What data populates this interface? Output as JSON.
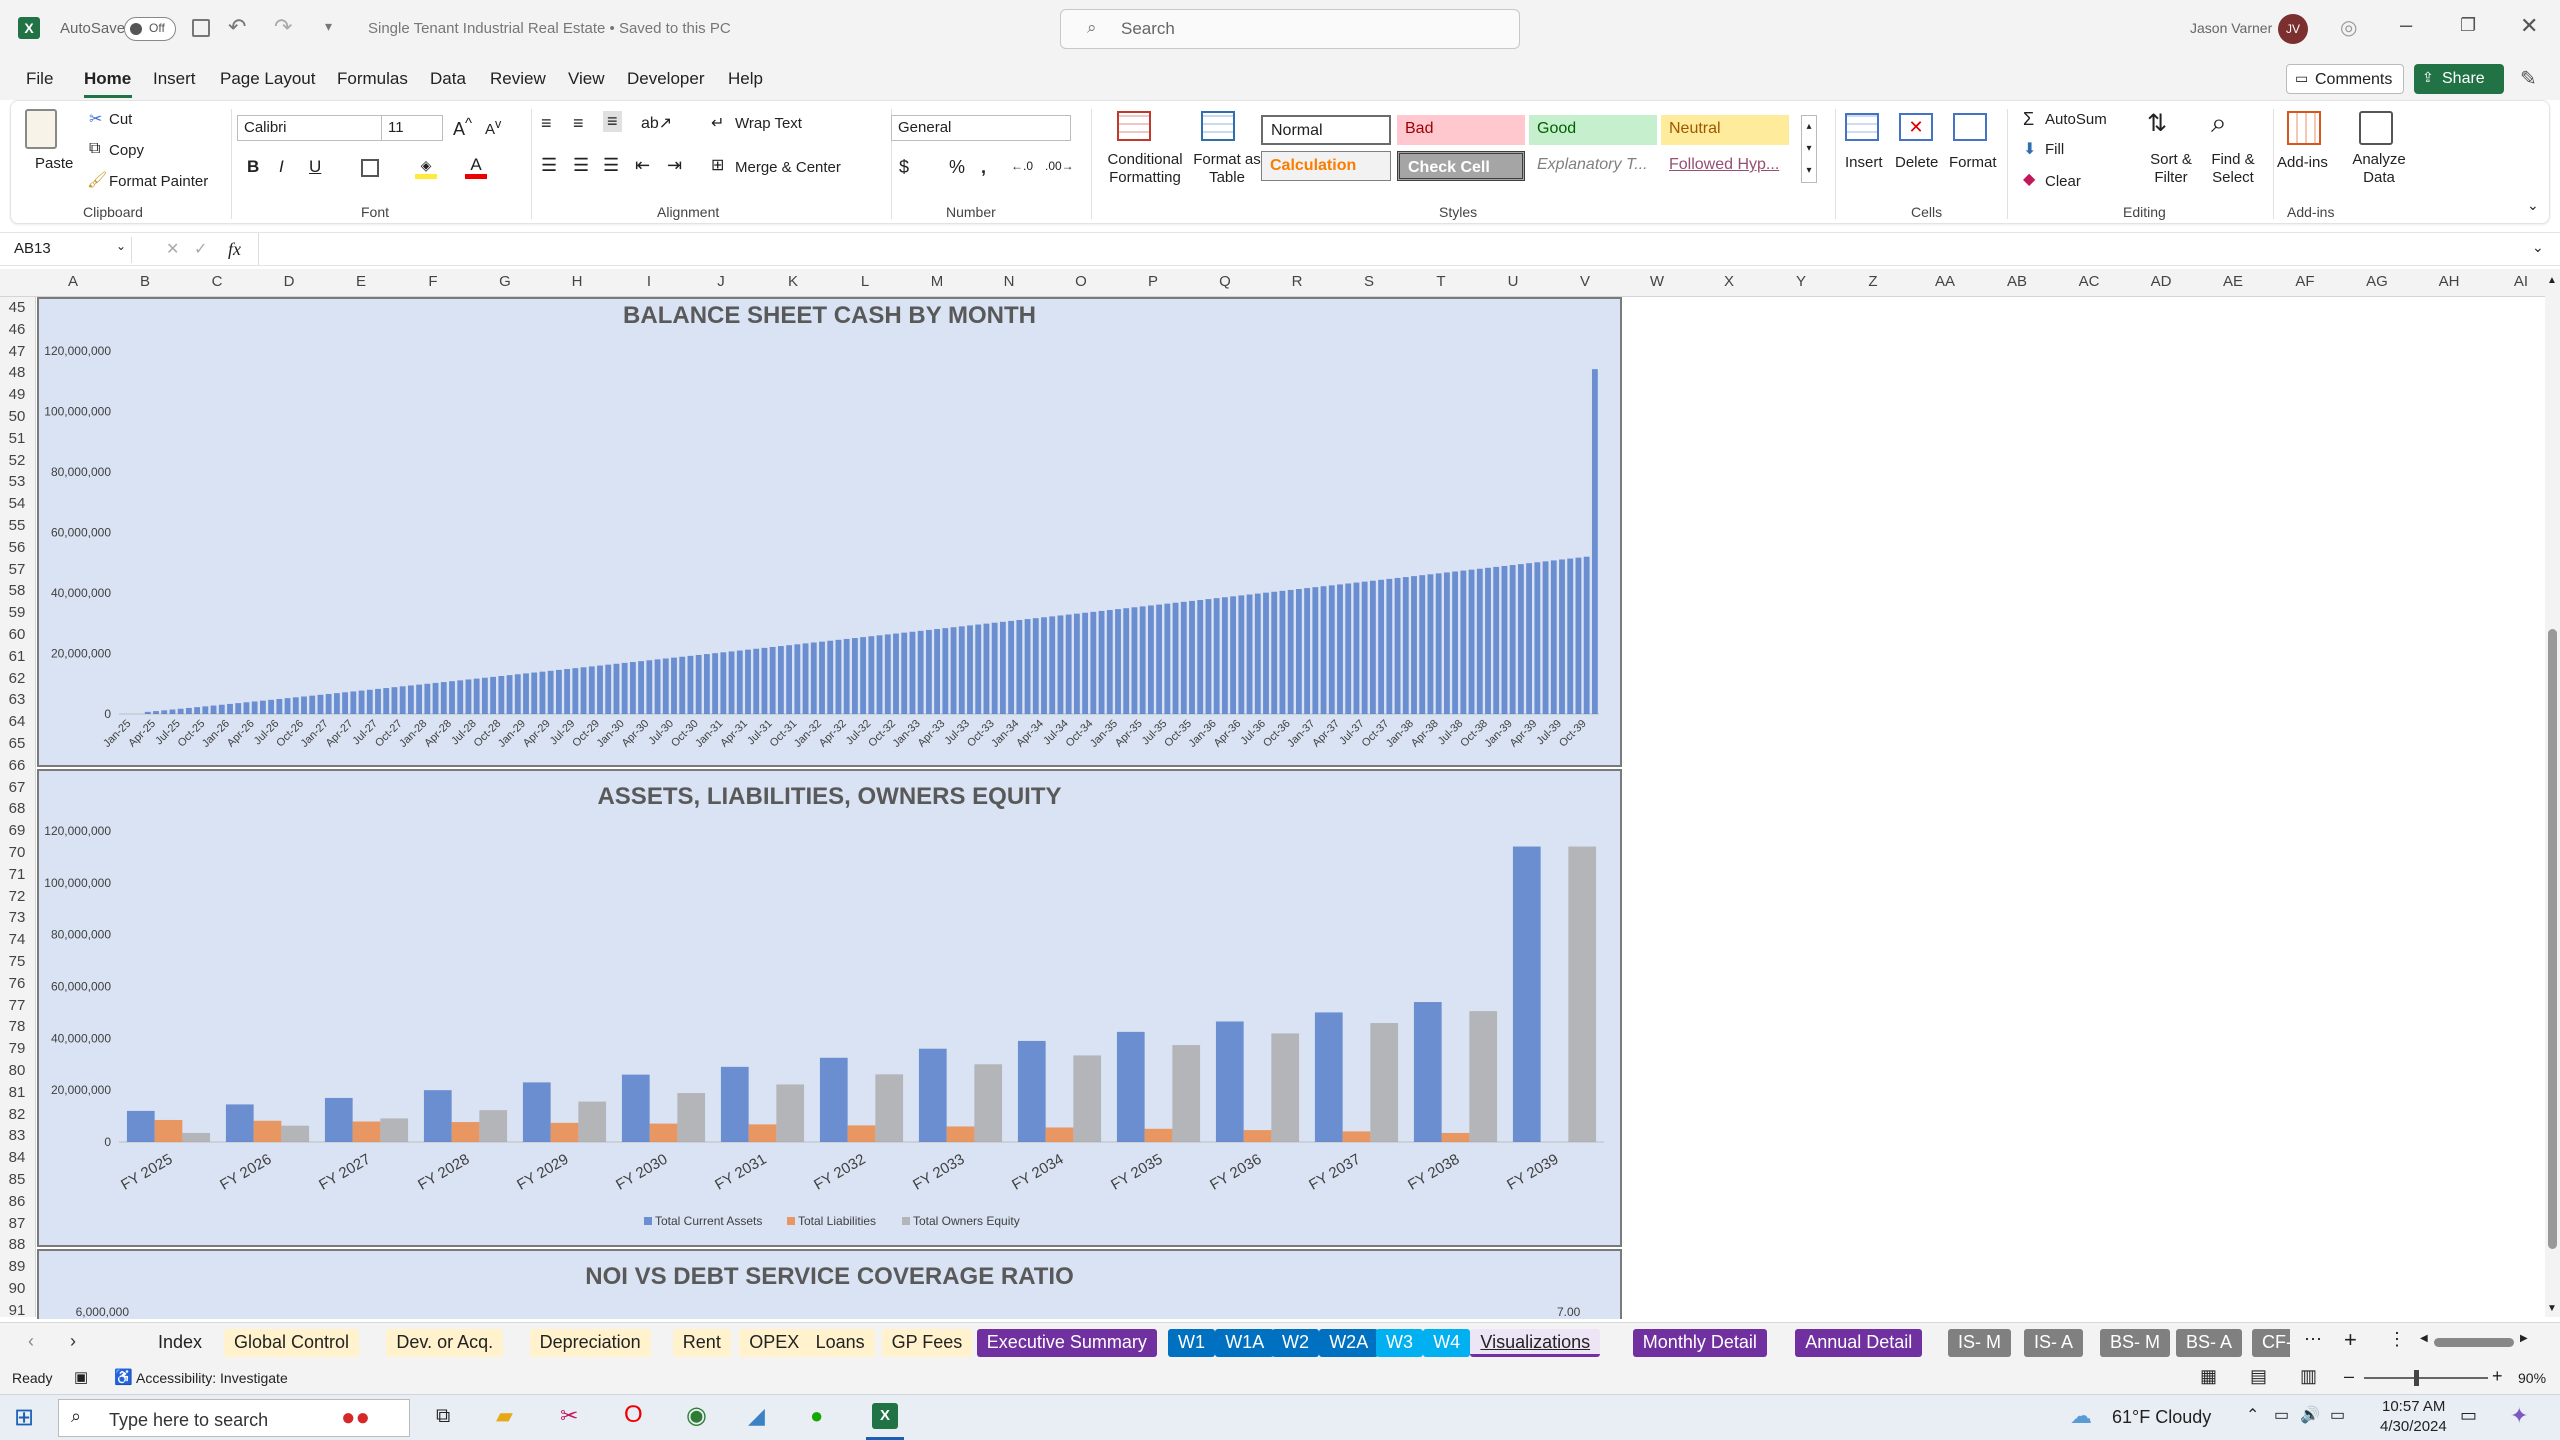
{
  "app": {
    "autosave_label": "AutoSave",
    "autosave_state": "Off",
    "doc_title": "Single Tenant Industrial Real Estate • Saved to this PC",
    "search_placeholder": "Search",
    "user_name": "Jason Varner",
    "user_initials": "JV",
    "excel_color": "#217346"
  },
  "menu": {
    "items": [
      "File",
      "Home",
      "Insert",
      "Page Layout",
      "Formulas",
      "Data",
      "Review",
      "View",
      "Developer",
      "Help"
    ],
    "active": "Home",
    "comments_label": "Comments",
    "share_label": "Share"
  },
  "ribbon": {
    "clipboard": {
      "paste": "Paste",
      "cut": "Cut",
      "copy": "Copy",
      "format_painter": "Format Painter",
      "group": "Clipboard"
    },
    "font": {
      "name": "Calibri",
      "size": "11",
      "group": "Font",
      "bold": "B",
      "italic": "I",
      "underline": "U"
    },
    "alignment": {
      "wrap": "Wrap Text",
      "merge": "Merge & Center",
      "group": "Alignment"
    },
    "number": {
      "format": "General",
      "group": "Number"
    },
    "styles": {
      "conditional": "Conditional Formatting",
      "format_table": "Format as Table",
      "cells": [
        "Normal",
        "Bad",
        "Good",
        "Neutral",
        "Calculation",
        "Check Cell",
        "Explanatory T...",
        "Followed Hyp..."
      ],
      "group": "Styles"
    },
    "cells": {
      "insert": "Insert",
      "delete": "Delete",
      "format": "Format",
      "group": "Cells"
    },
    "editing": {
      "autosum": "AutoSum",
      "fill": "Fill",
      "clear": "Clear",
      "sort": "Sort & Filter",
      "find": "Find & Select",
      "group": "Editing"
    },
    "addins": {
      "addins": "Add-ins",
      "analyze": "Analyze Data",
      "group": "Add-ins"
    }
  },
  "formula_bar": {
    "name_box": "AB13",
    "fx": "fx",
    "value": ""
  },
  "columns": [
    "A",
    "B",
    "C",
    "D",
    "E",
    "F",
    "G",
    "H",
    "I",
    "J",
    "K",
    "L",
    "M",
    "N",
    "O",
    "P",
    "Q",
    "R",
    "S",
    "T",
    "U",
    "V",
    "W",
    "X",
    "Y",
    "Z",
    "AA",
    "AB",
    "AC",
    "AD",
    "AE",
    "AF",
    "AG",
    "AH",
    "AI"
  ],
  "rows": [
    "45",
    "46",
    "47",
    "48",
    "49",
    "50",
    "51",
    "52",
    "53",
    "54",
    "55",
    "56",
    "57",
    "58",
    "59",
    "60",
    "61",
    "62",
    "63",
    "64",
    "65",
    "66",
    "67",
    "68",
    "69",
    "70",
    "71",
    "72",
    "73",
    "74",
    "75",
    "76",
    "77",
    "78",
    "79",
    "80",
    "81",
    "82",
    "83",
    "84",
    "85",
    "86",
    "87",
    "88",
    "89",
    "90",
    "91"
  ],
  "chart_data": [
    {
      "type": "bar",
      "title": "BALANCE SHEET CASH BY MONTH",
      "ylim": [
        0,
        120000000
      ],
      "yticks": [
        "0",
        "20,000,000",
        "40,000,000",
        "60,000,000",
        "80,000,000",
        "100,000,000",
        "120,000,000"
      ],
      "xlabels": [
        "Jan-25",
        "Apr-25",
        "Jul-25",
        "Oct-25",
        "Jan-26",
        "Apr-26",
        "Jul-26",
        "Oct-26",
        "Jan-27",
        "Apr-27",
        "Jul-27",
        "Oct-27",
        "Jan-28",
        "Apr-28",
        "Jul-28",
        "Oct-28",
        "Jan-29",
        "Apr-29",
        "Jul-29",
        "Oct-29",
        "Jan-30",
        "Apr-30",
        "Jul-30",
        "Oct-30",
        "Jan-31",
        "Apr-31",
        "Jul-31",
        "Oct-31",
        "Jan-32",
        "Apr-32",
        "Jul-32",
        "Oct-32",
        "Jan-33",
        "Apr-33",
        "Jul-33",
        "Oct-33",
        "Jan-34",
        "Apr-34",
        "Jul-34",
        "Oct-34",
        "Jan-35",
        "Apr-35",
        "Jul-35",
        "Oct-35",
        "Jan-36",
        "Apr-36",
        "Jul-36",
        "Oct-36",
        "Jan-37",
        "Apr-37",
        "Jul-37",
        "Oct-37",
        "Jan-38",
        "Apr-38",
        "Jul-38",
        "Oct-38",
        "Jan-39",
        "Apr-39",
        "Jul-39",
        "Oct-39"
      ],
      "months": 180,
      "start_value": 0,
      "end_value": 52000000,
      "final_value": 114000000,
      "bar_color": "#4472c4"
    },
    {
      "type": "bar",
      "title": "ASSETS, LIABILITIES, OWNERS EQUITY",
      "ylim": [
        0,
        120000000
      ],
      "yticks": [
        "0",
        "20,000,000",
        "40,000,000",
        "60,000,000",
        "80,000,000",
        "100,000,000",
        "120,000,000"
      ],
      "categories": [
        "FY 2025",
        "FY 2026",
        "FY 2027",
        "FY 2028",
        "FY 2029",
        "FY 2030",
        "FY 2031",
        "FY 2032",
        "FY 2033",
        "FY 2034",
        "FY 2035",
        "FY 2036",
        "FY 2037",
        "FY 2038",
        "FY 2039"
      ],
      "series": [
        {
          "name": "Total Current Assets",
          "color": "#4472c4",
          "values": [
            12000000,
            14500000,
            17000000,
            20000000,
            23000000,
            26000000,
            29000000,
            32500000,
            36000000,
            39000000,
            42500000,
            46500000,
            50000000,
            54000000,
            114000000
          ]
        },
        {
          "name": "Total Liabilities",
          "color": "#ed7d31",
          "values": [
            8500000,
            8200000,
            7900000,
            7700000,
            7400000,
            7100000,
            6800000,
            6400000,
            6000000,
            5600000,
            5100000,
            4600000,
            4100000,
            3500000,
            0
          ]
        },
        {
          "name": "Total Owners Equity",
          "color": "#a5a5a5",
          "values": [
            3500000,
            6300000,
            9100000,
            12300000,
            15600000,
            18900000,
            22200000,
            26100000,
            30000000,
            33400000,
            37400000,
            41900000,
            45900000,
            50500000,
            114000000
          ]
        }
      ]
    },
    {
      "type": "bar",
      "title": "NOI VS DEBT SERVICE COVERAGE RATIO",
      "ytick_left_top": "6,000,000",
      "ytick_right_top": "7.00"
    }
  ],
  "sheet_tabs": [
    {
      "label": "Index",
      "bg": "#f3f3f3",
      "fg": "#222"
    },
    {
      "label": "Global Control",
      "bg": "#fff2cc",
      "fg": "#222"
    },
    {
      "label": "Dev. or Acq.",
      "bg": "#fff2cc",
      "fg": "#222"
    },
    {
      "label": "Depreciation",
      "bg": "#fff2cc",
      "fg": "#222"
    },
    {
      "label": "Rent",
      "bg": "#fff2cc",
      "fg": "#222"
    },
    {
      "label": "OPEX",
      "bg": "#fff2cc",
      "fg": "#222"
    },
    {
      "label": "Loans",
      "bg": "#fff2cc",
      "fg": "#222"
    },
    {
      "label": "GP Fees",
      "bg": "#fff2cc",
      "fg": "#222"
    },
    {
      "label": "Executive Summary",
      "bg": "#7030a0",
      "fg": "#fff"
    },
    {
      "label": "W1",
      "bg": "#0070c0",
      "fg": "#fff"
    },
    {
      "label": "W1A",
      "bg": "#0070c0",
      "fg": "#fff"
    },
    {
      "label": "W2",
      "bg": "#0070c0",
      "fg": "#fff"
    },
    {
      "label": "W2A",
      "bg": "#0070c0",
      "fg": "#fff"
    },
    {
      "label": "W3",
      "bg": "#00b0f0",
      "fg": "#fff"
    },
    {
      "label": "W4",
      "bg": "#00b0f0",
      "fg": "#fff"
    },
    {
      "label": "Visualizations",
      "bg": "#ede4f5",
      "fg": "#222"
    },
    {
      "label": "Monthly Detail",
      "bg": "#7030a0",
      "fg": "#fff"
    },
    {
      "label": "Annual Detail",
      "bg": "#7030a0",
      "fg": "#fff"
    },
    {
      "label": "IS- M",
      "bg": "#808080",
      "fg": "#fff"
    },
    {
      "label": "IS- A",
      "bg": "#808080",
      "fg": "#fff"
    },
    {
      "label": "BS- M",
      "bg": "#808080",
      "fg": "#fff"
    },
    {
      "label": "BS- A",
      "bg": "#808080",
      "fg": "#fff"
    },
    {
      "label": "CF- M",
      "bg": "#808080",
      "fg": "#fff"
    }
  ],
  "status": {
    "ready": "Ready",
    "accessibility": "Accessibility: Investigate",
    "zoom": "90%"
  },
  "taskbar": {
    "search_placeholder": "Type here to search",
    "weather": "61°F  Cloudy",
    "time": "10:57 AM",
    "date": "4/30/2024"
  }
}
